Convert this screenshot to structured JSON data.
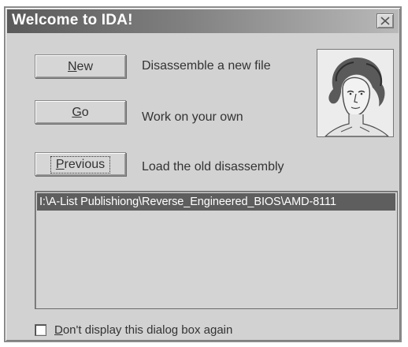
{
  "window": {
    "title": "Welcome to IDA!"
  },
  "buttons": {
    "new": {
      "mnemonic": "N",
      "rest": "ew"
    },
    "go": {
      "mnemonic": "G",
      "rest": "o"
    },
    "previous": {
      "mnemonic": "P",
      "rest": "revious"
    }
  },
  "descriptions": {
    "new": "Disassemble a new file",
    "go": "Work on your own",
    "previous": "Load the old disassembly"
  },
  "file_list": {
    "items": [
      "I:\\A-List Publishiong\\Reverse_Engineered_BIOS\\AMD-8111"
    ],
    "selected_index": 0
  },
  "checkbox": {
    "mnemonic": "D",
    "rest": "on't display this dialog box again",
    "checked": false
  },
  "icons": {
    "close": "close-icon",
    "portrait": "portrait-image"
  },
  "colors": {
    "title_start": "#5a5a5a",
    "title_end": "#b9b9b9",
    "dialog_bg": "#d2d2d2",
    "selection_bg": "#5e5e5e"
  }
}
